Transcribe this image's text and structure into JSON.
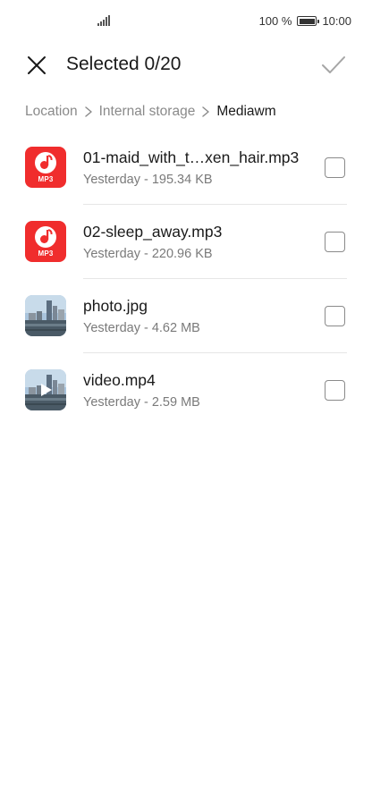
{
  "status_bar": {
    "battery_percent": "100 %",
    "time": "10:00",
    "signal_icon": "signal-icon",
    "battery_icon": "battery-icon"
  },
  "header": {
    "title": "Selected 0/20",
    "close_icon": "close-icon",
    "confirm_icon": "check-icon"
  },
  "breadcrumb": {
    "items": [
      "Location",
      "Internal storage",
      "Mediawm"
    ],
    "separator_icon": "chevron-right-icon"
  },
  "files": [
    {
      "name": "01-maid_with_t…xen_hair.mp3",
      "meta": "Yesterday - 195.34 KB",
      "type": "mp3",
      "thumb_label": "MP3",
      "checked": false
    },
    {
      "name": "02-sleep_away.mp3",
      "meta": "Yesterday - 220.96 KB",
      "type": "mp3",
      "thumb_label": "MP3",
      "checked": false
    },
    {
      "name": "photo.jpg",
      "meta": "Yesterday - 4.62 MB",
      "type": "image",
      "checked": false
    },
    {
      "name": "video.mp4",
      "meta": "Yesterday - 2.59 MB",
      "type": "video",
      "checked": false
    }
  ],
  "colors": {
    "mp3_red": "#f02d2d",
    "text_primary": "#1a1a1a",
    "text_secondary": "#7a7a7a",
    "divider": "#e6e6e6"
  }
}
